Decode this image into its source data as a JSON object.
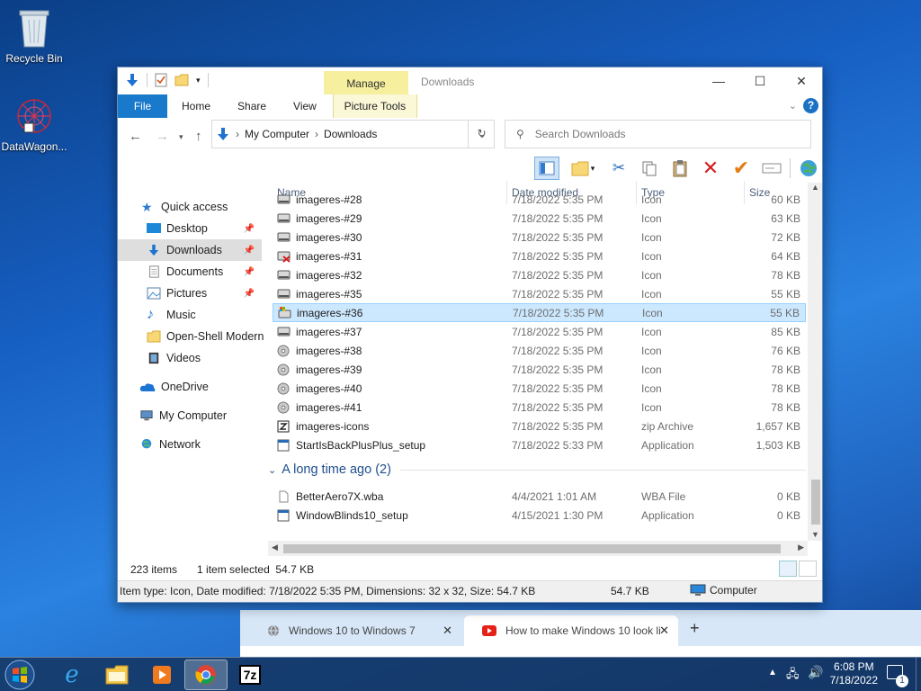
{
  "desktop": {
    "icons": [
      {
        "label": "Recycle Bin",
        "icon": "recycle-bin-icon"
      },
      {
        "label": "DataWagon...",
        "icon": "datawagon-icon"
      }
    ]
  },
  "browser": {
    "tabs": [
      {
        "label": "Windows 10 to Windows 7",
        "close": "✕"
      },
      {
        "label": "How to make Windows 10 look li",
        "close": "✕"
      }
    ],
    "new_tab": "+",
    "url": "youtube.com/watch?v=b1jTf3yxLa0"
  },
  "explorer": {
    "title": "Downloads",
    "contextual_tab_group": "Manage",
    "ribbon_tabs": [
      "File",
      "Home",
      "Share",
      "View",
      "Picture Tools"
    ],
    "caption_buttons": {
      "minimize": "—",
      "maximize": "☐",
      "close": "✕"
    },
    "help": "?",
    "address": {
      "segments": [
        "My Computer",
        "Downloads"
      ]
    },
    "search": {
      "placeholder": "Search Downloads"
    },
    "nav": [
      {
        "label": "Quick access",
        "icon": "star-icon",
        "pinned": false
      },
      {
        "label": "Desktop",
        "icon": "desktop-icon",
        "pinned": true
      },
      {
        "label": "Downloads",
        "icon": "downloads-icon",
        "pinned": true,
        "selected": true
      },
      {
        "label": "Documents",
        "icon": "documents-icon",
        "pinned": true
      },
      {
        "label": "Pictures",
        "icon": "pictures-icon",
        "pinned": true
      },
      {
        "label": "Music",
        "icon": "music-icon",
        "pinned": false
      },
      {
        "label": "Open-Shell Modern",
        "icon": "folder-icon",
        "pinned": false
      },
      {
        "label": "Videos",
        "icon": "videos-icon",
        "pinned": false
      },
      {
        "label": "OneDrive",
        "icon": "onedrive-icon",
        "pinned": false
      },
      {
        "label": "My Computer",
        "icon": "computer-icon",
        "pinned": false
      },
      {
        "label": "Network",
        "icon": "network-icon",
        "pinned": false
      }
    ],
    "columns": {
      "name": "Name",
      "date": "Date modified",
      "type": "Type",
      "size": "Size"
    },
    "files": [
      {
        "name": "imageres-#28",
        "date": "7/18/2022 5:35 PM",
        "type": "Icon",
        "size": "60 KB",
        "icon": "drive-icon"
      },
      {
        "name": "imageres-#29",
        "date": "7/18/2022 5:35 PM",
        "type": "Icon",
        "size": "63 KB",
        "icon": "drive-icon"
      },
      {
        "name": "imageres-#30",
        "date": "7/18/2022 5:35 PM",
        "type": "Icon",
        "size": "72 KB",
        "icon": "drive-icon"
      },
      {
        "name": "imageres-#31",
        "date": "7/18/2022 5:35 PM",
        "type": "Icon",
        "size": "64 KB",
        "icon": "drive-error-icon"
      },
      {
        "name": "imageres-#32",
        "date": "7/18/2022 5:35 PM",
        "type": "Icon",
        "size": "78 KB",
        "icon": "drive-icon"
      },
      {
        "name": "imageres-#35",
        "date": "7/18/2022 5:35 PM",
        "type": "Icon",
        "size": "55 KB",
        "icon": "drive-icon"
      },
      {
        "name": "imageres-#36",
        "date": "7/18/2022 5:35 PM",
        "type": "Icon",
        "size": "55 KB",
        "icon": "system-drive-icon",
        "selected": true
      },
      {
        "name": "imageres-#37",
        "date": "7/18/2022 5:35 PM",
        "type": "Icon",
        "size": "85 KB",
        "icon": "drive-icon"
      },
      {
        "name": "imageres-#38",
        "date": "7/18/2022 5:35 PM",
        "type": "Icon",
        "size": "76 KB",
        "icon": "disc-icon"
      },
      {
        "name": "imageres-#39",
        "date": "7/18/2022 5:35 PM",
        "type": "Icon",
        "size": "78 KB",
        "icon": "disc-icon"
      },
      {
        "name": "imageres-#40",
        "date": "7/18/2022 5:35 PM",
        "type": "Icon",
        "size": "78 KB",
        "icon": "disc-icon"
      },
      {
        "name": "imageres-#41",
        "date": "7/18/2022 5:35 PM",
        "type": "Icon",
        "size": "78 KB",
        "icon": "disc-icon"
      },
      {
        "name": "imageres-icons",
        "date": "7/18/2022 5:35 PM",
        "type": "zip Archive",
        "size": "1,657 KB",
        "icon": "zip-icon"
      },
      {
        "name": "StartIsBackPlusPlus_setup",
        "date": "7/18/2022 5:33 PM",
        "type": "Application",
        "size": "1,503 KB",
        "icon": "application-icon"
      }
    ],
    "group_header": "A long time ago (2)",
    "group_files": [
      {
        "name": "BetterAero7X.wba",
        "date": "4/4/2021 1:01 AM",
        "type": "WBA File",
        "size": "0 KB",
        "icon": "file-icon"
      },
      {
        "name": "WindowBlinds10_setup",
        "date": "4/15/2021 1:30 PM",
        "type": "Application",
        "size": "0 KB",
        "icon": "application-icon"
      }
    ],
    "status": {
      "count": "223 items",
      "selected": "1 item selected  54.7 KB"
    },
    "details_bar": {
      "info": "Item type: Icon, Date modified: 7/18/2022 5:35 PM, Dimensions: 32 x 32, Size: 54.7 KB",
      "size": "54.7 KB",
      "location": "Computer"
    }
  },
  "taskbar": {
    "apps": [
      "ie-icon",
      "explorer-icon",
      "media-player-icon",
      "chrome-icon",
      "7zip-icon"
    ],
    "time": "6:08 PM",
    "date": "7/18/2022",
    "notification_count": "1"
  }
}
